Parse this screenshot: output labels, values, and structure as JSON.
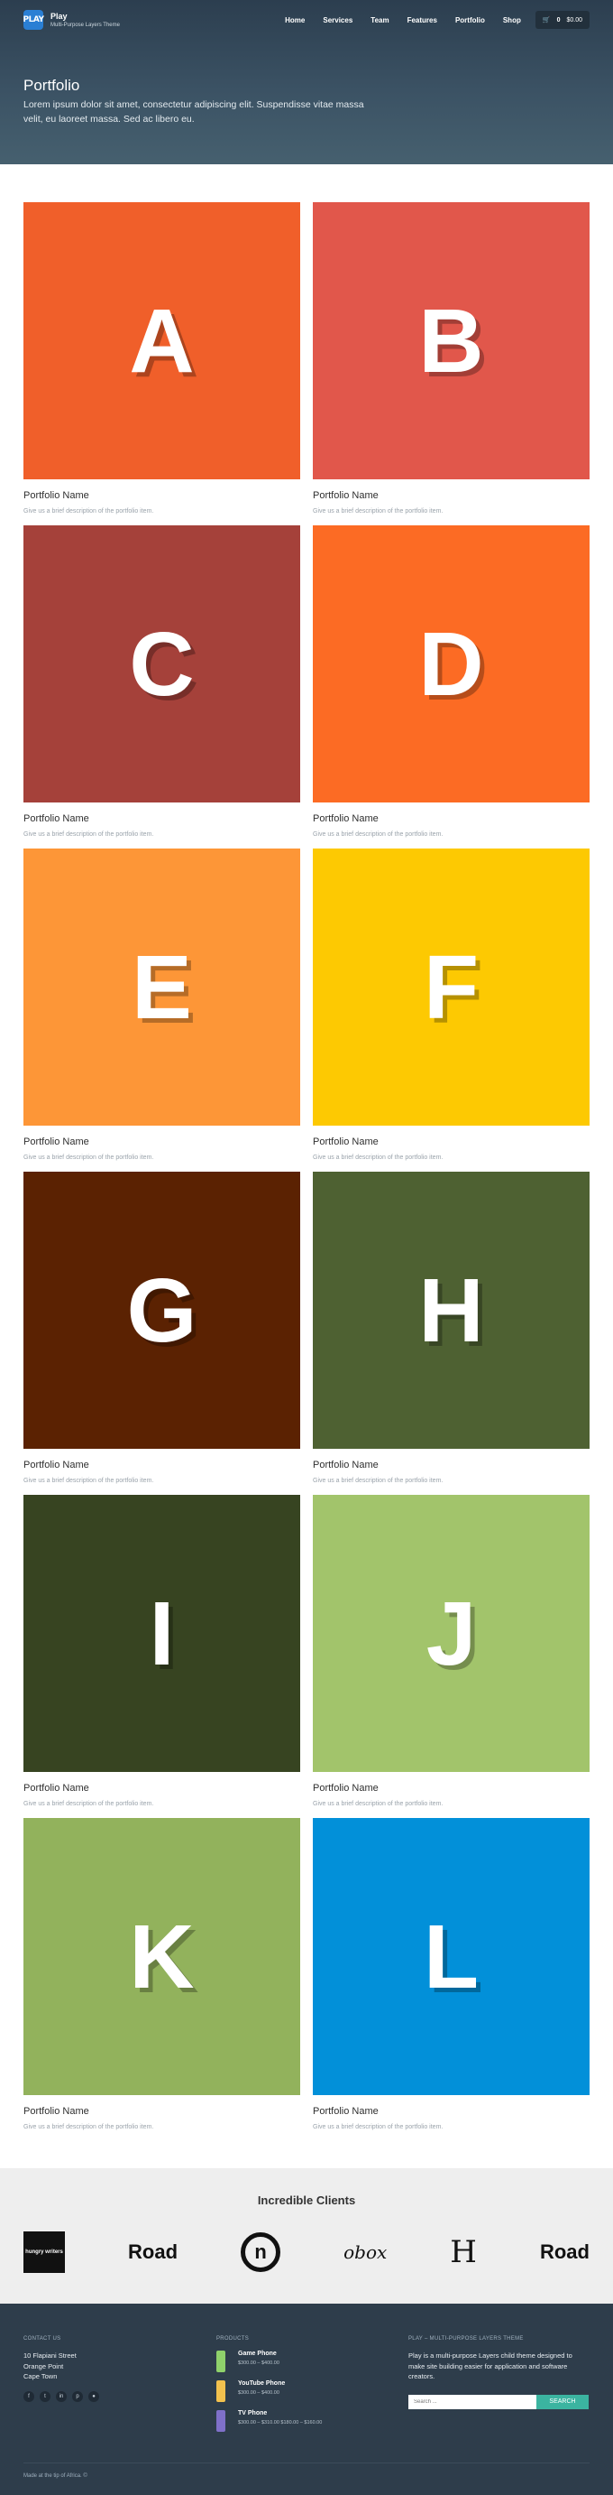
{
  "header": {
    "brand_name": "Play",
    "brand_tagline": "Multi-Purpose Layers Theme",
    "logo_text": "PLAY",
    "nav": [
      "Home",
      "Services",
      "Team",
      "Features",
      "Portfolio",
      "Shop"
    ],
    "cart_count": "0",
    "cart_total": "$0.00",
    "cart_icon": "cart-icon"
  },
  "hero": {
    "title": "Portfolio",
    "description": "Lorem ipsum dolor sit amet, consectetur adipiscing elit. Suspendisse vitae massa velit, eu laoreet massa. Sed ac libero eu."
  },
  "portfolio": [
    {
      "letter": "A",
      "color": "#f05f2a",
      "title": "Portfolio Name",
      "desc": "Give us a brief description of the portfolio item."
    },
    {
      "letter": "B",
      "color": "#e1574b",
      "title": "Portfolio Name",
      "desc": "Give us a brief description of the portfolio item."
    },
    {
      "letter": "C",
      "color": "#a5413a",
      "title": "Portfolio Name",
      "desc": "Give us a brief description of the portfolio item."
    },
    {
      "letter": "D",
      "color": "#fc6b24",
      "title": "Portfolio Name",
      "desc": "Give us a brief description of the portfolio item."
    },
    {
      "letter": "E",
      "color": "#fd9637",
      "title": "Portfolio Name",
      "desc": "Give us a brief description of the portfolio item."
    },
    {
      "letter": "F",
      "color": "#fdc902",
      "title": "Portfolio Name",
      "desc": "Give us a brief description of the portfolio item."
    },
    {
      "letter": "G",
      "color": "#5b2202",
      "title": "Portfolio Name",
      "desc": "Give us a brief description of the portfolio item."
    },
    {
      "letter": "H",
      "color": "#4e6132",
      "title": "Portfolio Name",
      "desc": "Give us a brief description of the portfolio item."
    },
    {
      "letter": "I",
      "color": "#374421",
      "title": "Portfolio Name",
      "desc": "Give us a brief description of the portfolio item."
    },
    {
      "letter": "J",
      "color": "#a2c46b",
      "title": "Portfolio Name",
      "desc": "Give us a brief description of the portfolio item."
    },
    {
      "letter": "K",
      "color": "#92b25c",
      "title": "Portfolio Name",
      "desc": "Give us a brief description of the portfolio item."
    },
    {
      "letter": "L",
      "color": "#0290d9",
      "title": "Portfolio Name",
      "desc": "Give us a brief description of the portfolio item."
    }
  ],
  "clients": {
    "title": "Incredible Clients",
    "logos": [
      "hungry writers",
      "Road",
      "n",
      "obox",
      "H",
      "Road"
    ]
  },
  "footer": {
    "contact_heading": "CONTACT US",
    "address": [
      "10 Flapiani Street",
      "Orange Point",
      "Cape Town"
    ],
    "social_icons": [
      "facebook-icon",
      "twitter-icon",
      "linkedin-icon",
      "pinterest-icon",
      "dribbble-icon"
    ],
    "products_heading": "PRODUCTS",
    "products": [
      {
        "name": "Game Phone",
        "price": "$300.00 – $400.00",
        "color": "#8fd16b"
      },
      {
        "name": "YouTube Phone",
        "price": "$300.00 – $400.00",
        "color": "#f2c14e"
      },
      {
        "name": "TV Phone",
        "price": "$300.00 – $310.00 $180.00 – $160.00",
        "color": "#7f70c9"
      }
    ],
    "about_heading": "PLAY – MULTI-PURPOSE LAYERS THEME",
    "about_text": "Play is a multi-purpose Layers child theme designed to make site building easier for application and software creators.",
    "search_placeholder": "Search ...",
    "search_button": "SEARCH",
    "copyright": "Made at the tip of Africa. ©"
  }
}
